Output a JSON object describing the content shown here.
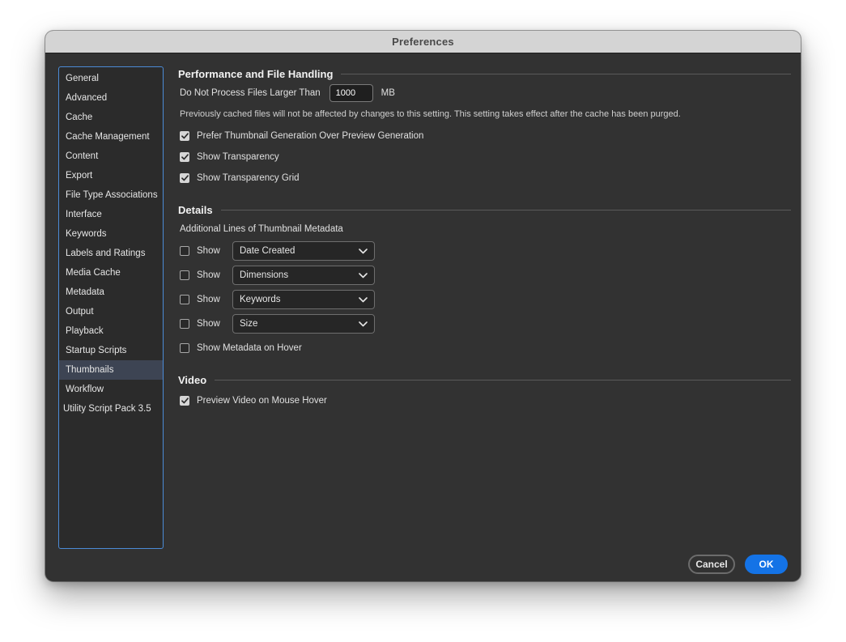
{
  "window": {
    "title": "Preferences"
  },
  "sidebar": {
    "items": [
      {
        "label": "General"
      },
      {
        "label": "Advanced"
      },
      {
        "label": "Cache"
      },
      {
        "label": "Cache Management"
      },
      {
        "label": "Content"
      },
      {
        "label": "Export"
      },
      {
        "label": "File Type Associations"
      },
      {
        "label": "Interface"
      },
      {
        "label": "Keywords"
      },
      {
        "label": "Labels and Ratings"
      },
      {
        "label": "Media Cache"
      },
      {
        "label": "Metadata"
      },
      {
        "label": "Output"
      },
      {
        "label": "Playback"
      },
      {
        "label": "Startup Scripts"
      },
      {
        "label": "Thumbnails"
      },
      {
        "label": "Workflow"
      },
      {
        "label": "Utility Script Pack 3.5"
      }
    ],
    "selected": "Thumbnails"
  },
  "performance": {
    "heading": "Performance and File Handling",
    "max_size_label": "Do Not Process Files Larger Than",
    "max_size_value": "1000",
    "max_size_unit": "MB",
    "note": "Previously cached files will not be affected by changes to this setting. This setting takes effect after the cache has been purged.",
    "options": [
      {
        "label": "Prefer Thumbnail Generation Over Preview Generation",
        "checked": true
      },
      {
        "label": "Show Transparency",
        "checked": true
      },
      {
        "label": "Show Transparency Grid",
        "checked": true
      }
    ]
  },
  "details": {
    "heading": "Details",
    "sub_label": "Additional Lines of Thumbnail Metadata",
    "show_label": "Show",
    "lines": [
      {
        "value": "Date Created",
        "checked": false
      },
      {
        "value": "Dimensions",
        "checked": false
      },
      {
        "value": "Keywords",
        "checked": false
      },
      {
        "value": "Size",
        "checked": false
      }
    ],
    "hover_label": "Show Metadata on Hover",
    "hover_checked": false
  },
  "video": {
    "heading": "Video",
    "preview_label": "Preview Video on Mouse Hover",
    "preview_checked": true
  },
  "buttons": {
    "cancel": "Cancel",
    "ok": "OK"
  },
  "colors": {
    "accent": "#1473e6",
    "selection": "#3d4453",
    "focus_border": "#4b8bd6"
  }
}
